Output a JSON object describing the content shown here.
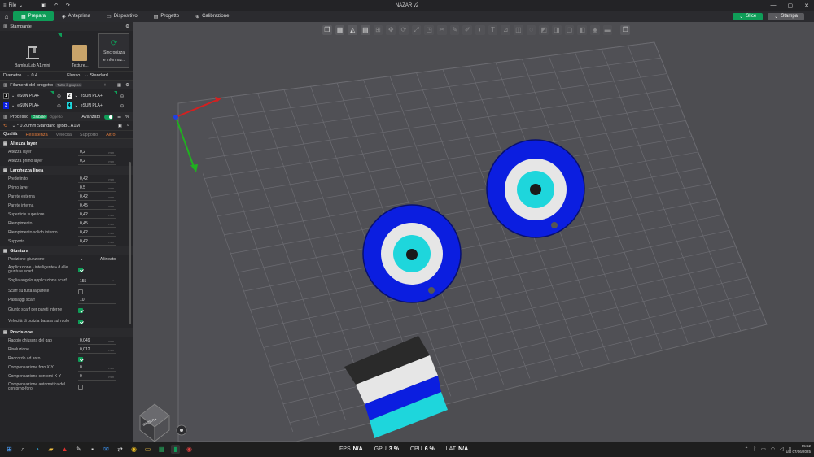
{
  "titlebar": {
    "file": "File",
    "title": "NAZAR v2"
  },
  "nav": {
    "tabs": [
      "Prepara",
      "Anteprima",
      "Dispositivo",
      "Progetto",
      "Calibrazione"
    ],
    "slice": "Slice",
    "print": "Stampa"
  },
  "printer": {
    "header": "Stampante",
    "machine": "Bambu Lab A1 mini",
    "plate": "Texture...",
    "sync_l1": "Sincronizza",
    "sync_l2": "le informaz..."
  },
  "diameter": {
    "label": "Diametro",
    "value": "0.4",
    "flow_label": "Flusso",
    "flow_value": "Standard"
  },
  "filaments": {
    "header": "Filamenti del progetto",
    "badge": "Tutto il gruppo",
    "items": [
      {
        "num": "1",
        "name": "eSUN PLA+",
        "color": "#0b0b0b"
      },
      {
        "num": "2",
        "name": "eSUN PLA+",
        "color": "#f2f2f2"
      },
      {
        "num": "3",
        "name": "eSUN PLA+",
        "color": "#0b1ee0"
      },
      {
        "num": "4",
        "name": "eSUN PLA+",
        "color": "#1ed6dc"
      }
    ]
  },
  "process": {
    "header": "Processo",
    "global": "Globale",
    "object": "Oggetto",
    "advanced": "Avanzato",
    "preset": "* 0.20mm Standard @BBL A1M",
    "tabs": [
      "Qualità",
      "Resistenza",
      "Velocità",
      "Supporto",
      "Altro"
    ]
  },
  "groups": {
    "layer": {
      "title": "Altezza layer",
      "rows": [
        {
          "label": "Altezza layer",
          "value": "0,2",
          "unit": "mm"
        },
        {
          "label": "Altezza primo layer",
          "value": "0,2",
          "unit": "mm"
        }
      ]
    },
    "width": {
      "title": "Larghezza linea",
      "rows": [
        {
          "label": "Predefinito",
          "value": "0,42",
          "unit": "mm"
        },
        {
          "label": "Primo layer",
          "value": "0,5",
          "unit": "mm"
        },
        {
          "label": "Parete esterna",
          "value": "0,42",
          "unit": "mm"
        },
        {
          "label": "Parete interna",
          "value": "0,45",
          "unit": "mm"
        },
        {
          "label": "Superficie superiore",
          "value": "0,42",
          "unit": "mm"
        },
        {
          "label": "Riempimento",
          "value": "0,45",
          "unit": "mm"
        },
        {
          "label": "Riempimento solido interno",
          "value": "0,42",
          "unit": "mm"
        },
        {
          "label": "Supporto",
          "value": "0,42",
          "unit": "mm"
        }
      ]
    },
    "seam": {
      "title": "Giuntura",
      "position_label": "Posizione giunzione",
      "position_value": "Allineato",
      "smart_label": "Applicazione • intelligente • d elle giunture scarf",
      "angle_label": "Soglia angolo applicazione scarf",
      "angle_value": "155",
      "angle_unit": "°",
      "full_label": "Scarf su tutta la parete",
      "steps_label": "Passaggi scarf",
      "steps_value": "10",
      "inner_label": "Giunto scarf per pareti interne",
      "wipe_label": "Velocità di pulizia basata sul ruolo"
    },
    "precision": {
      "title": "Precisione",
      "gap_label": "Raggio chiusura del gap",
      "gap_value": "0,049",
      "res_label": "Risoluzione",
      "res_value": "0,012",
      "res_unit": "mm",
      "arc_label": "Raccordo ad arco",
      "hole_label": "Compensazione foro X-Y",
      "hole_value": "0",
      "hole_unit": "mm",
      "contour_label": "Compensazione contorni X-Y",
      "contour_value": "0",
      "contour_unit": "mm",
      "auto_label": "Compensazione automatica del contorno-foro"
    }
  },
  "viewport": {
    "cube_label": "SINISTRA"
  },
  "stats": [
    {
      "label": "FPS",
      "value": "N/A"
    },
    {
      "label": "GPU",
      "value": "3 %"
    },
    {
      "label": "CPU",
      "value": "6 %"
    },
    {
      "label": "LAT",
      "value": "N/A"
    }
  ],
  "clock": {
    "time": "05:52",
    "date": "sab 07/06/2025"
  },
  "colors": {
    "accent": "#0f9d58",
    "blue": "#0b1ee0",
    "cyan": "#1ed6dc"
  }
}
